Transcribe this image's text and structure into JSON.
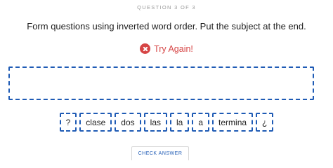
{
  "header": {
    "counter": "QUESTION 3 OF 3"
  },
  "instructions": "Form questions using inverted word order. Put the subject at the end.",
  "feedback": {
    "icon": "x-circle-icon",
    "text": "Try Again!",
    "color": "#d64545"
  },
  "accent_color": "#1f5bb5",
  "word_bank": [
    "?",
    "clase",
    "dos",
    "las",
    "la",
    "a",
    "termina",
    "¿"
  ],
  "check_button": {
    "label": "CHECK ANSWER"
  }
}
